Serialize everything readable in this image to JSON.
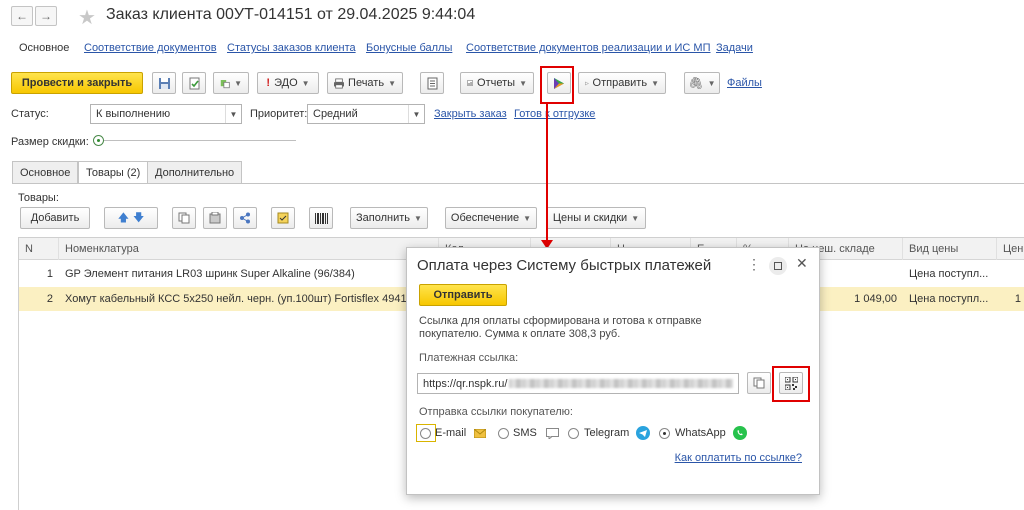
{
  "window": {
    "title": "Заказ клиента 00УТ-014151 от 29.04.2025 9:44:04",
    "nav_back": "←",
    "nav_forward": "→"
  },
  "section_links": [
    "Основное",
    "Соответствие документов",
    "Статусы заказов клиента",
    "Бонусные баллы",
    "Соответствие документов реализации и ИС МП",
    "Задачи"
  ],
  "toolbar": {
    "post_close": "Провести и закрыть",
    "edo": "ЭДО",
    "print": "Печать",
    "reports": "Отчеты",
    "send": "Отправить",
    "files": "Файлы"
  },
  "form": {
    "status_label": "Статус:",
    "status_value": "К выполнению",
    "priority_label": "Приоритет:",
    "priority_value": "Средний",
    "close_order": "Закрыть заказ",
    "ready_shipment": "Готов к отгрузке",
    "discount_label": "Размер скидки:"
  },
  "tabs": [
    "Основное",
    "Товары (2)",
    "Дополнительно"
  ],
  "goods": {
    "label": "Товары:",
    "add": "Добавить",
    "fill": "Заполнить",
    "supply": "Обеспечение",
    "prices": "Цены и скидки"
  },
  "table": {
    "columns": [
      "N",
      "Номенклатура",
      "Кол",
      "",
      "Ц",
      "Е",
      "%",
      "На неш. складе",
      "Вид цены",
      "Цен"
    ],
    "rows": [
      {
        "n": "1",
        "name": "GP Элемент питания LR03 шринк Super Alkaline (96/384)",
        "stock": "",
        "price_type": "Цена поступл...",
        "extra": ""
      },
      {
        "n": "2",
        "name": "Хомут кабельный КСС 5х250 нейл. черн. (уп.100шт) Fortisflex 49416",
        "stock": "1 049,00",
        "price_type": "Цена поступл...",
        "extra": "1"
      }
    ]
  },
  "dialog": {
    "title": "Оплата через Систему быстрых платежей",
    "send_button": "Отправить",
    "info_line1": "Ссылка для оплаты сформирована и готова к отправке",
    "info_line2": "покупателю. Сумма к оплате 308,3 руб.",
    "link_label": "Платежная ссылка:",
    "link_value": "https://qr.nspk.ru/",
    "send_label": "Отправка ссылки покупателю:",
    "options": [
      "E-mail",
      "SMS",
      "Telegram",
      "WhatsApp"
    ],
    "selected_option": "WhatsApp",
    "help_link": "Как оплатить по ссылке?"
  },
  "colors": {
    "accent_yellow": "#f7c700",
    "highlight_row": "#fbf0c2",
    "annotation_red": "#e00000",
    "link_blue": "#2a55a8"
  }
}
